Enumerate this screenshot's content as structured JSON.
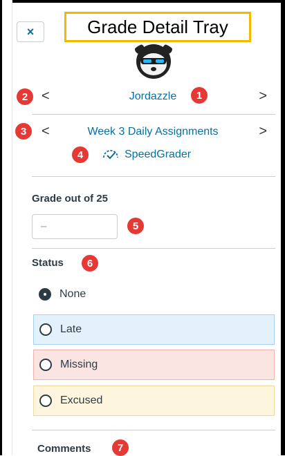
{
  "tray": {
    "title": "Grade Detail Tray",
    "close_label": "×"
  },
  "student": {
    "name": "Jordazzle",
    "prev_label": "<",
    "next_label": ">"
  },
  "assignment": {
    "name": "Week 3 Daily Assignments",
    "prev_label": "<",
    "next_label": ">",
    "speedgrader_label": "SpeedGrader"
  },
  "grade": {
    "label": "Grade out of 25",
    "value": "–"
  },
  "status": {
    "label": "Status",
    "options": [
      {
        "label": "None",
        "selected": true
      },
      {
        "label": "Late",
        "selected": false
      },
      {
        "label": "Missing",
        "selected": false
      },
      {
        "label": "Excused",
        "selected": false
      }
    ]
  },
  "comments": {
    "label": "Comments"
  },
  "callouts": [
    "1",
    "2",
    "3",
    "4",
    "5",
    "6",
    "7"
  ],
  "colors": {
    "link": "#0770a3",
    "callout": "#e53935",
    "title_border": "#f5b800",
    "late_bg": "#e3f1fb",
    "missing_bg": "#fbe5e3",
    "excused_bg": "#fdf5de"
  }
}
